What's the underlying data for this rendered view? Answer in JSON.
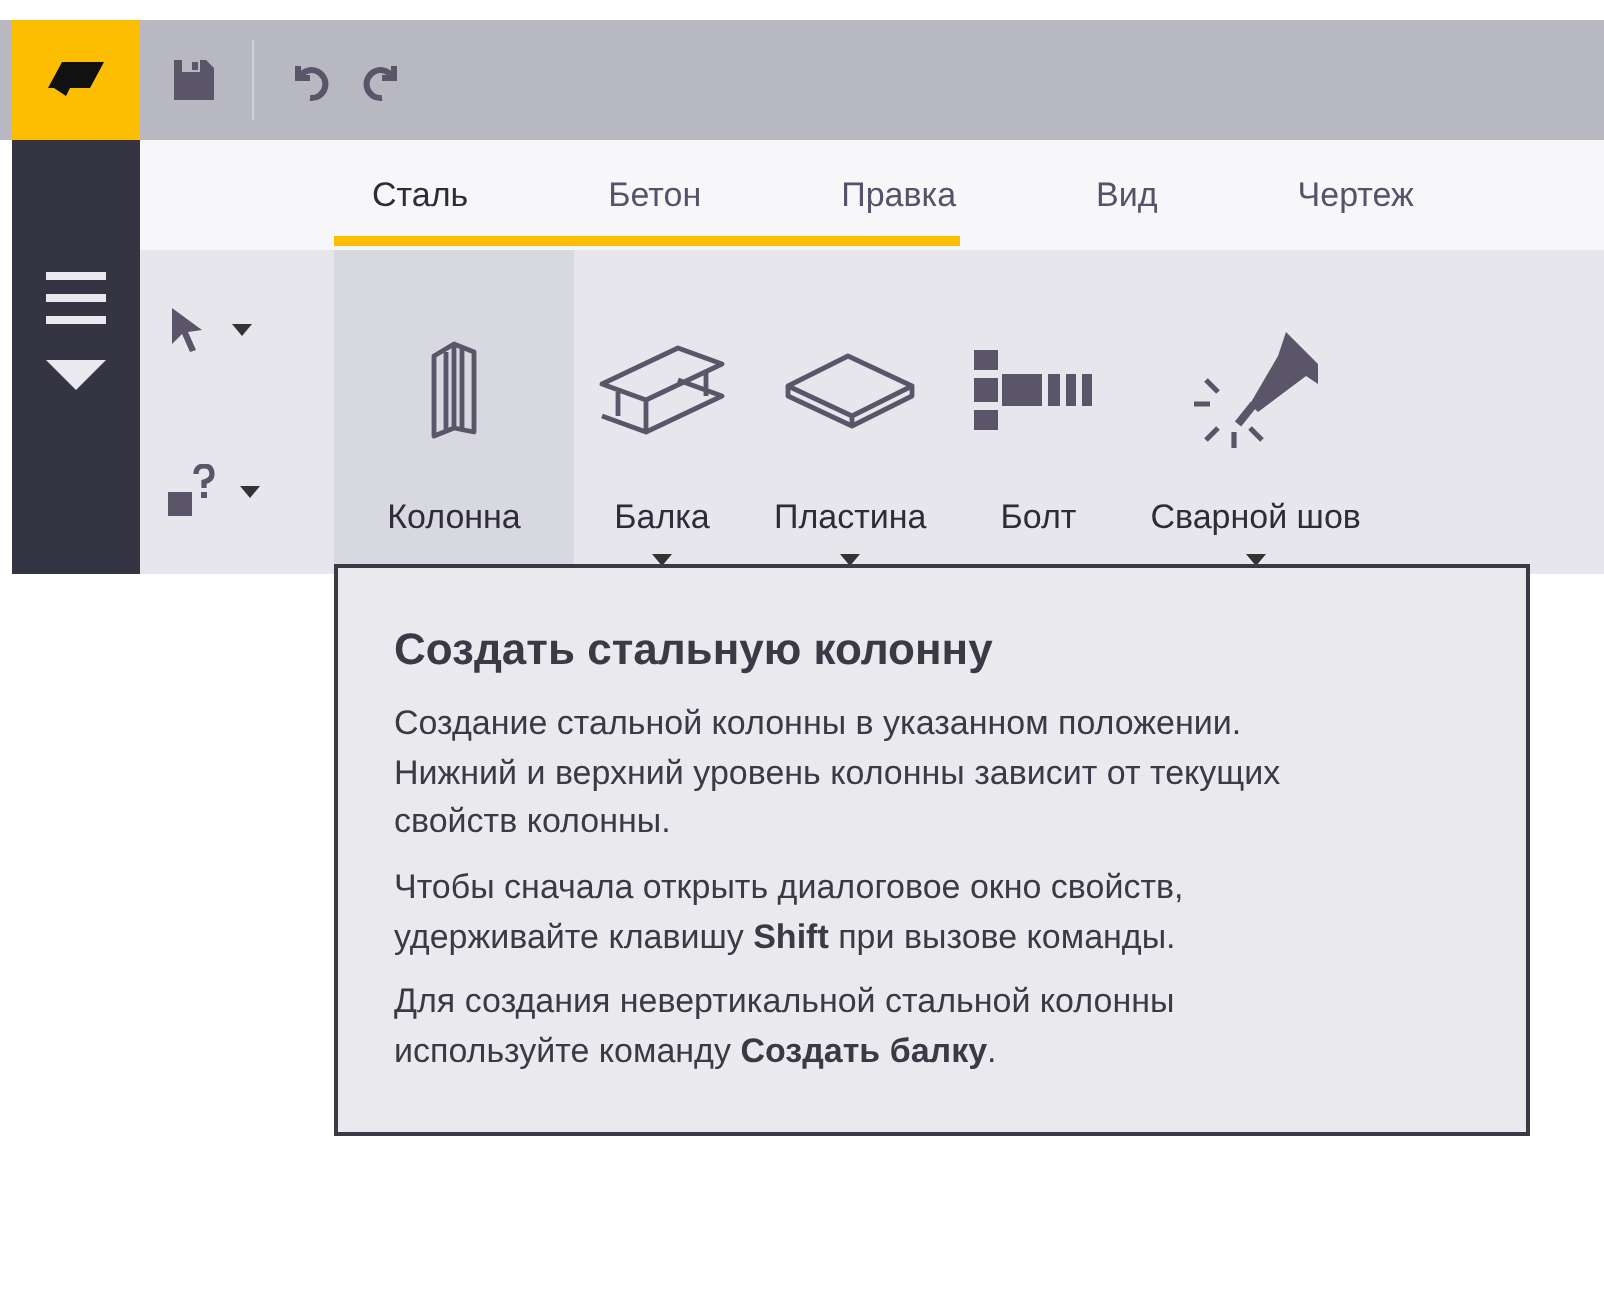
{
  "tabs": [
    {
      "label": "Сталь",
      "selected": true
    },
    {
      "label": "Бетон",
      "selected": false
    },
    {
      "label": "Правка",
      "selected": false
    },
    {
      "label": "Вид",
      "selected": false
    },
    {
      "label": "Чертеж",
      "selected": false
    }
  ],
  "tools": [
    {
      "label": "Колонна",
      "kind": "column",
      "selected": true,
      "dropdown": false
    },
    {
      "label": "Балка",
      "kind": "beam",
      "selected": false,
      "dropdown": true
    },
    {
      "label": "Пластина",
      "kind": "plate",
      "selected": false,
      "dropdown": true
    },
    {
      "label": "Болт",
      "kind": "bolt",
      "selected": false,
      "dropdown": false
    },
    {
      "label": "Сварной шов",
      "kind": "weld",
      "selected": false,
      "dropdown": true
    }
  ],
  "tooltip": {
    "title": "Создать стальную колонну",
    "paragraphs": [
      "Создание стальной колонны в указанном положении. Нижний и верхний уровень колонны зависит от текущих свойств колонны.",
      "Чтобы сначала открыть диалоговое окно свойств, удерживайте клавишу **Shift** при вызове команды.",
      "Для создания невертикальной стальной колонны используйте команду **Создать балку**."
    ]
  }
}
